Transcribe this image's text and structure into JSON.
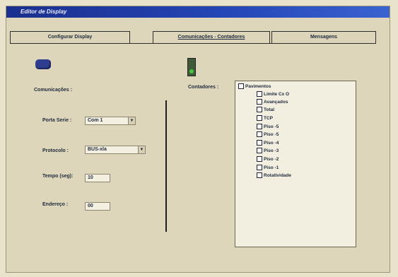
{
  "window": {
    "title": "Editor de Display"
  },
  "tabs": [
    {
      "label": "Configurar Display"
    },
    {
      "label": "Comunicações - Contadores"
    },
    {
      "label": "Mensagens"
    }
  ],
  "left": {
    "section_label": "Comunicações :",
    "porta_serie_label": "Porta Serie :",
    "porta_serie_value": "Com 1",
    "protocolo_label": "Protocolo :",
    "protocolo_value": "BUS-xla",
    "tempo_label": "Tempo (seg):",
    "tempo_value": "10",
    "endereco_label": "Endereço :",
    "endereco_value": "00"
  },
  "right": {
    "contadores_label": "Contadores :",
    "tree_root": "Pavimentos",
    "tree_items": [
      "Limite Cx O",
      "Avançados",
      "Total",
      "TCP",
      "Piso -5",
      "Piso -5",
      "Piso -4",
      "Piso -3",
      "Piso -2",
      "Piso -1",
      "Rotatividade"
    ]
  }
}
